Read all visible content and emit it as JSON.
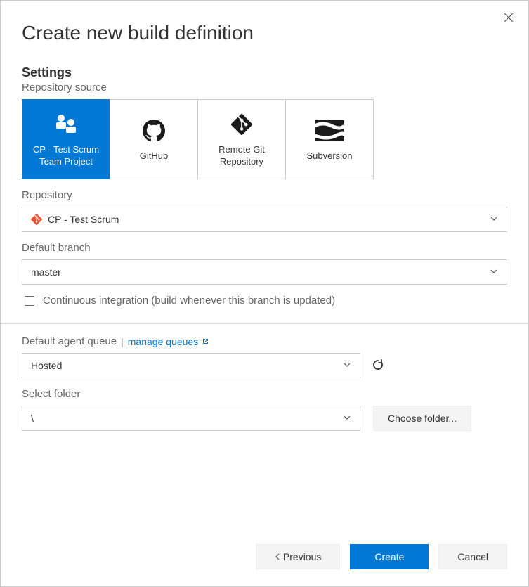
{
  "dialog": {
    "title": "Create new build definition"
  },
  "settings": {
    "heading": "Settings",
    "repo_source_label": "Repository source",
    "sources": [
      {
        "label": "CP - Test Scrum Team Project",
        "icon": "team-icon",
        "selected": true
      },
      {
        "label": "GitHub",
        "icon": "github-icon",
        "selected": false
      },
      {
        "label": "Remote Git Repository",
        "icon": "git-icon",
        "selected": false
      },
      {
        "label": "Subversion",
        "icon": "subversion-icon",
        "selected": false
      }
    ],
    "repository_label": "Repository",
    "repository_value": "CP - Test Scrum",
    "default_branch_label": "Default branch",
    "default_branch_value": "master",
    "ci_checkbox_label": "Continuous integration (build whenever this branch is updated)",
    "ci_checked": false,
    "agent_queue_label": "Default agent queue",
    "manage_queues_link": "manage queues",
    "agent_queue_value": "Hosted",
    "select_folder_label": "Select folder",
    "select_folder_value": "\\",
    "choose_folder_button": "Choose folder..."
  },
  "footer": {
    "previous": "Previous",
    "create": "Create",
    "cancel": "Cancel"
  }
}
